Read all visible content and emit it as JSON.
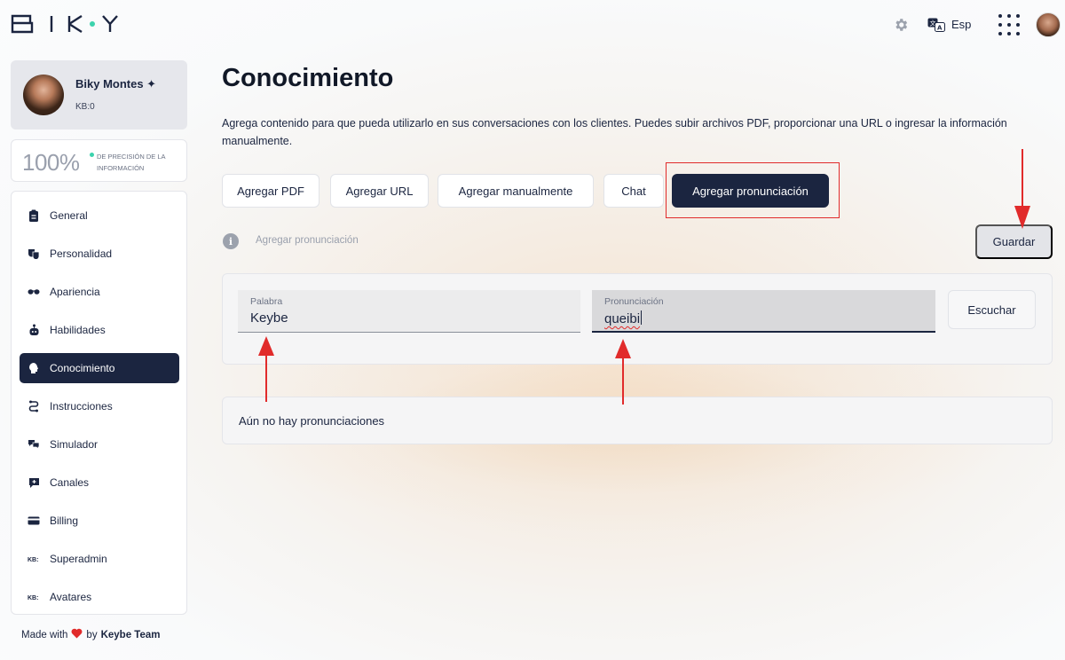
{
  "app": {
    "logo_text": "BIKY"
  },
  "topbar": {
    "language": "Esp"
  },
  "profile": {
    "name": "Biky Montes ✦",
    "kb": "KB:0"
  },
  "precision": {
    "value": "100%",
    "label": "DE PRECISIÓN DE LA INFORMACIÓN"
  },
  "sidebar": {
    "items": [
      {
        "label": "General",
        "icon": "clipboard-icon"
      },
      {
        "label": "Personalidad",
        "icon": "masks-icon"
      },
      {
        "label": "Apariencia",
        "icon": "sunglasses-icon"
      },
      {
        "label": "Habilidades",
        "icon": "robot-icon"
      },
      {
        "label": "Conocimiento",
        "icon": "brain-icon",
        "active": true
      },
      {
        "label": "Instrucciones",
        "icon": "route-icon"
      },
      {
        "label": "Simulador",
        "icon": "chat-bubbles-icon"
      },
      {
        "label": "Canales",
        "icon": "chat-plus-icon"
      },
      {
        "label": "Billing",
        "icon": "credit-card-icon"
      },
      {
        "label": "Superadmin",
        "icon": "kb-icon"
      },
      {
        "label": "Avatares",
        "icon": "kb-icon"
      }
    ],
    "footer": {
      "prefix": "Made with",
      "middle": "by",
      "team": "Keybe Team"
    }
  },
  "main": {
    "title": "Conocimiento",
    "description": "Agrega contenido para que pueda utilizarlo en sus conversaciones con los clientes. Puedes subir archivos PDF, proporcionar una URL o ingresar la información manualmente.",
    "tabs": [
      {
        "label": "Agregar PDF"
      },
      {
        "label": "Agregar URL"
      },
      {
        "label": "Agregar manualmente"
      },
      {
        "label": "Chat"
      },
      {
        "label": "Agregar pronunciación",
        "active": true
      }
    ],
    "section_label": "Agregar pronunciación",
    "save_label": "Guardar",
    "form": {
      "word_label": "Palabra",
      "word_value": "Keybe",
      "pron_label": "Pronunciación",
      "pron_value": "queibi",
      "listen_label": "Escuchar"
    },
    "empty_message": "Aún no hay pronunciaciones"
  },
  "colors": {
    "primary": "#1b2540",
    "accent_green": "#3cd3ad",
    "annotation_red": "#e12b2b"
  }
}
